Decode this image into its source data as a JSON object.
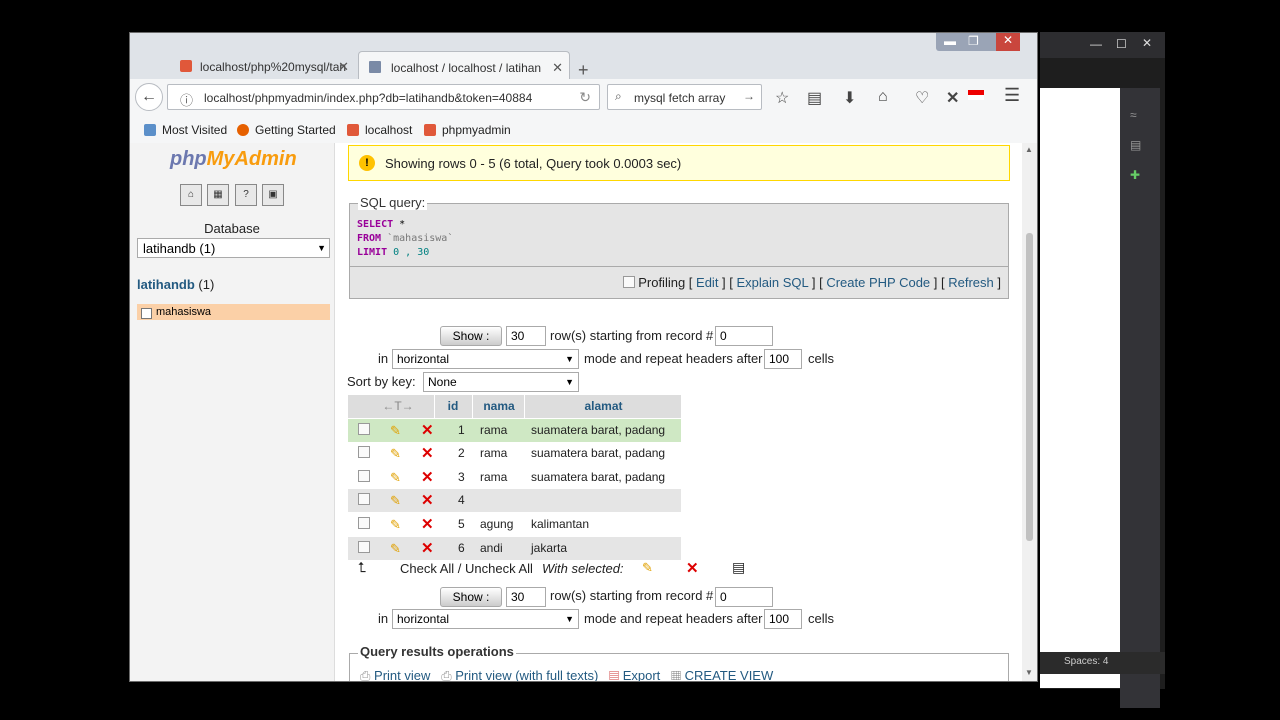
{
  "browser": {
    "tabs": [
      {
        "title": "localhost/php%20mysql/tan"
      },
      {
        "title": "localhost / localhost / latihan"
      }
    ],
    "url": "localhost/phpmyadmin/index.php?db=latihandb&token=40884",
    "search_value": "mysql fetch array",
    "bookmarks": [
      "Most Visited",
      "Getting Started",
      "localhost",
      "phpmyadmin"
    ]
  },
  "sidebar": {
    "logo_php": "php",
    "logo_myadmin": "MyAdmin",
    "database_label": "Database",
    "database_select": "latihandb (1)",
    "db_name": "latihandb",
    "db_count": "(1)",
    "table_item": "mahasiswa"
  },
  "notice": "Showing rows 0 - 5 (6 total, Query took 0.0003 sec)",
  "sql": {
    "legend": "SQL query:",
    "select": "SELECT",
    "star": "*",
    "from": "FROM",
    "table": "`mahasiswa`",
    "limit": "LIMIT",
    "limit_values": "0 , 30",
    "profiling": "Profiling",
    "edit": "Edit",
    "explain": "Explain SQL",
    "create_php": "Create PHP Code",
    "refresh": "Refresh"
  },
  "nav_top": {
    "show_label": "Show :",
    "rows_value": "30",
    "rows_text": "row(s) starting from record #",
    "record_value": "0",
    "in_text": "in",
    "mode_value": "horizontal",
    "mode_text": "mode and repeat headers after",
    "headers_value": "100",
    "cells_text": "cells"
  },
  "sort": {
    "label": "Sort by key:",
    "value": "None"
  },
  "table": {
    "arrows": "←T→",
    "columns": [
      "id",
      "nama",
      "alamat"
    ],
    "rows": [
      {
        "id": "1",
        "nama": "rama",
        "alamat": "suamatera barat, padang"
      },
      {
        "id": "2",
        "nama": "rama",
        "alamat": "suamatera barat, padang"
      },
      {
        "id": "3",
        "nama": "rama",
        "alamat": "suamatera barat, padang"
      },
      {
        "id": "4",
        "nama": "",
        "alamat": ""
      },
      {
        "id": "5",
        "nama": "agung",
        "alamat": "kalimantan"
      },
      {
        "id": "6",
        "nama": "andi",
        "alamat": "jakarta"
      }
    ]
  },
  "footer": {
    "check_all": "Check All / Uncheck All",
    "with_selected": "With selected:"
  },
  "nav_bottom": {
    "show_label": "Show :",
    "rows_value": "30",
    "rows_text": "row(s) starting from record #",
    "record_value": "0",
    "in_text": "in",
    "mode_value": "horizontal",
    "mode_text": "mode and repeat headers after",
    "headers_value": "100",
    "cells_text": "cells"
  },
  "ops": {
    "legend": "Query results operations",
    "links": [
      "Print view",
      "Print view (with full texts)",
      "Export",
      "CREATE VIEW"
    ]
  },
  "bgapp": {
    "status": "Spaces: 4"
  },
  "colors": {
    "accent_link": "#235a81",
    "highlight_row": "#cfe8c4",
    "table_item_bg": "#fbd0a7"
  }
}
